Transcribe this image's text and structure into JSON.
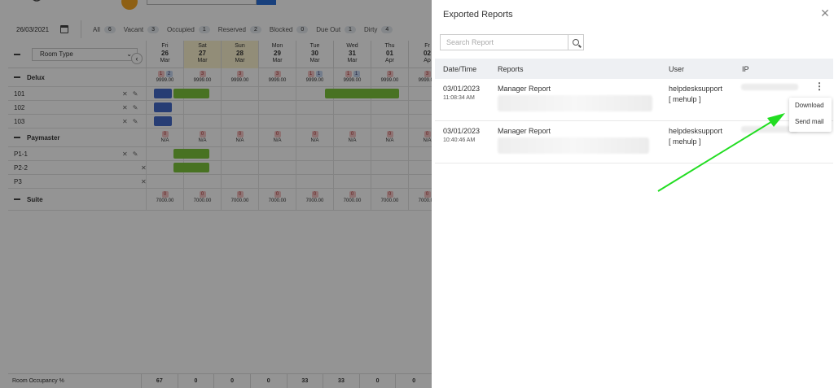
{
  "calendar": {
    "date": "26/03/2021",
    "room_type_label": "Room Type",
    "filters": [
      {
        "label": "All",
        "count": "6"
      },
      {
        "label": "Vacant",
        "count": "3"
      },
      {
        "label": "Occupied",
        "count": "1"
      },
      {
        "label": "Reserved",
        "count": "2"
      },
      {
        "label": "Blocked",
        "count": "0"
      },
      {
        "label": "Due Out",
        "count": "1"
      },
      {
        "label": "Dirty",
        "count": "4"
      }
    ],
    "days": [
      {
        "dow": "Fri",
        "num": "26",
        "mon": "Mar"
      },
      {
        "dow": "Sat",
        "num": "27",
        "mon": "Mar"
      },
      {
        "dow": "Sun",
        "num": "28",
        "mon": "Mar"
      },
      {
        "dow": "Mon",
        "num": "29",
        "mon": "Mar"
      },
      {
        "dow": "Tue",
        "num": "30",
        "mon": "Mar"
      },
      {
        "dow": "Wed",
        "num": "31",
        "mon": "Mar"
      },
      {
        "dow": "Thu",
        "num": "01",
        "mon": "Apr"
      },
      {
        "dow": "Fr",
        "num": "02",
        "mon": "Ap"
      }
    ],
    "categories": {
      "delux": {
        "name": "Delux",
        "rate": "9999.00",
        "rooms": [
          "101",
          "102",
          "103"
        ]
      },
      "paymaster": {
        "name": "Paymaster",
        "rate": "N/A",
        "rooms": [
          "P1-1",
          "P2-2",
          "P3"
        ]
      },
      "suite": {
        "name": "Suite",
        "rate": "7000.00"
      }
    },
    "occupancy_label": "Room Occupancy %",
    "occupancy": [
      "67",
      "0",
      "0",
      "0",
      "33",
      "33",
      "0",
      "0"
    ]
  },
  "panel": {
    "title": "Exported Reports",
    "search_placeholder": "Search Report",
    "columns": {
      "datetime": "Date/Time",
      "reports": "Reports",
      "user": "User",
      "ip": "IP"
    },
    "rows": [
      {
        "date": "03/01/2023",
        "time": "11:08:34 AM",
        "report": "Manager Report",
        "user": "helpdesksupport",
        "user2": "[ mehulp ]"
      },
      {
        "date": "03/01/2023",
        "time": "10:40:46 AM",
        "report": "Manager Report",
        "user": "helpdesksupport",
        "user2": "[ mehulp ]"
      }
    ],
    "menu": {
      "download": "Download",
      "send_mail": "Send mail"
    }
  },
  "colors": {
    "accent": "#2a6ed8",
    "arrow": "#22dd22",
    "booking_green": "#7dc53b",
    "booking_blue": "#4469c8"
  }
}
